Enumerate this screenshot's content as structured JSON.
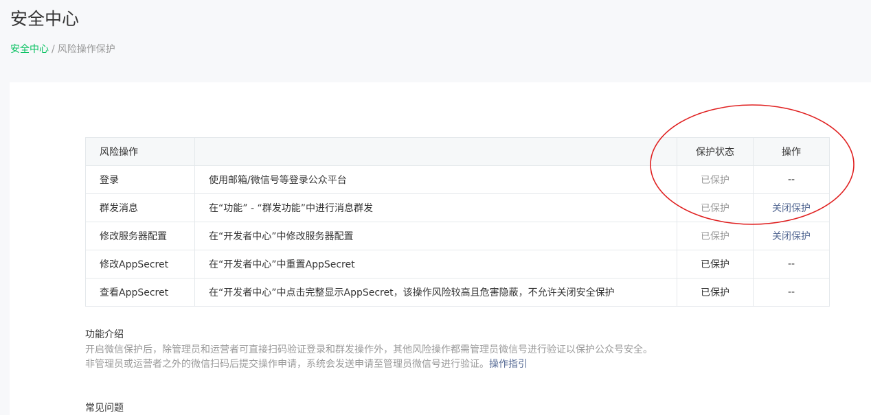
{
  "header": {
    "title": "安全中心",
    "breadcrumb": {
      "root": "安全中心",
      "separator": "/",
      "current": "风险操作保护"
    }
  },
  "table": {
    "headers": {
      "operation": "风险操作",
      "description": "",
      "status": "保护状态",
      "action": "操作"
    },
    "rows": [
      {
        "operation": "登录",
        "description": "使用邮箱/微信号等登录公众平台",
        "status": "已保护",
        "status_style": "muted",
        "action": "--",
        "action_is_link": false
      },
      {
        "operation": "群发消息",
        "description": "在“功能” - “群发功能”中进行消息群发",
        "status": "已保护",
        "status_style": "muted",
        "action": "关闭保护",
        "action_is_link": true
      },
      {
        "operation": "修改服务器配置",
        "description": "在“开发者中心”中修改服务器配置",
        "status": "已保护",
        "status_style": "muted",
        "action": "关闭保护",
        "action_is_link": true
      },
      {
        "operation": "修改AppSecret",
        "description": "在“开发者中心”中重置AppSecret",
        "status": "已保护",
        "status_style": "normal",
        "action": "--",
        "action_is_link": false
      },
      {
        "operation": "查看AppSecret",
        "description": "在“开发者中心”中点击完整显示AppSecret，该操作风险较高且危害隐蔽，不允许关闭安全保护",
        "status": "已保护",
        "status_style": "normal",
        "action": "--",
        "action_is_link": false
      }
    ]
  },
  "intro": {
    "title": "功能介绍",
    "line1": "开启微信保护后，除管理员和运营者可直接扫码验证登录和群发操作外，其他风险操作都需管理员微信号进行验证以保护公众号安全。",
    "line2": "非管理员或运营者之外的微信扫码后提交操作申请，系统会发送申请至管理员微信号进行验证。",
    "guide_link": "操作指引"
  },
  "faq": {
    "title": "常见问题"
  },
  "colors": {
    "accent_green": "#07c160",
    "link_blue": "#576b95",
    "annotation_red": "#e02020"
  }
}
